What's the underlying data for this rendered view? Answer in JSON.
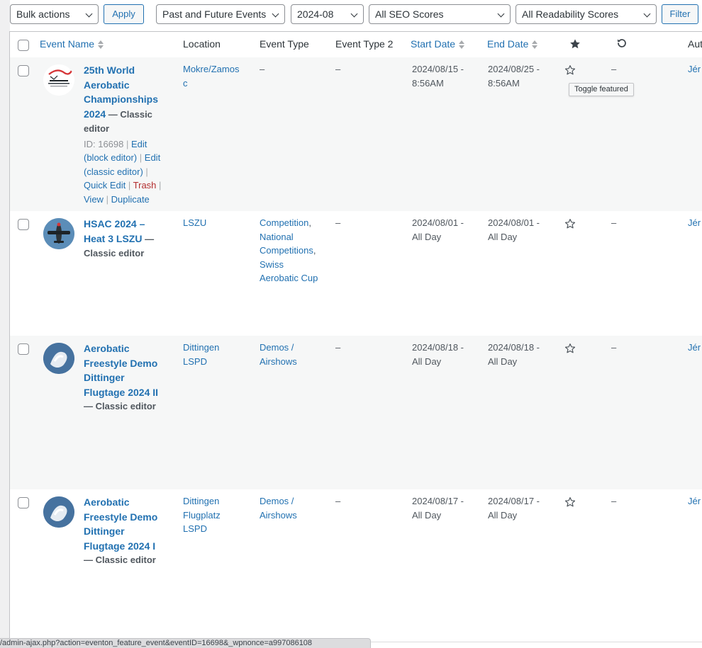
{
  "toolbar": {
    "bulk_actions": "Bulk actions",
    "apply": "Apply",
    "event_filter": "Past and Future Events",
    "month_filter": "2024-08",
    "seo_filter": "All SEO Scores",
    "readability_filter": "All Readability Scores",
    "filter": "Filter"
  },
  "columns": {
    "event_name": "Event Name",
    "location": "Location",
    "event_type": "Event Type",
    "event_type_2": "Event Type 2",
    "start_date": "Start Date",
    "end_date": "End Date",
    "featured_icon": "star-filled-icon",
    "repeat_icon": "repeat-icon",
    "author": "Aut"
  },
  "tooltip": "Toggle featured",
  "status_url": "/admin-ajax.php?action=eventon_feature_event&eventID=16698&_wpnonce=a997086108",
  "rows": [
    {
      "title_lines": [
        "25th World",
        "Aerobatic",
        "Championships"
      ],
      "title_last": "2024",
      "meta_inline": " — Classic",
      "meta_line": "editor",
      "actions": {
        "id": "ID: 16698",
        "edit_block_1": "Edit",
        "edit_block_2": "(block editor)",
        "edit_classic_1": "Edit",
        "edit_classic_2": "(classic editor)",
        "quick_edit": "Quick Edit",
        "trash": "Trash",
        "view": "View",
        "duplicate": "Duplicate"
      },
      "location_lines": [
        "Mokre/Zamos",
        "c"
      ],
      "type": "–",
      "type2": "–",
      "start": [
        "2024/08/15 -",
        "8:56AM"
      ],
      "end": [
        "2024/08/25 -",
        "8:56AM"
      ],
      "repeat": "–",
      "author": "Jér"
    },
    {
      "title_lines": [
        "HSAC 2024 –",
        "Heat 3 LSZU"
      ],
      "meta_inline": " —",
      "meta_line": "Classic editor",
      "location_lines": [
        "LSZU"
      ],
      "type_links": [
        "Competition",
        "National",
        "Competitions",
        "Swiss",
        "Aerobatic Cup"
      ],
      "type2": "–",
      "start": [
        "2024/08/01 -",
        "All Day"
      ],
      "end": [
        "2024/08/01 -",
        "All Day"
      ],
      "repeat": "–",
      "author": "Jér"
    },
    {
      "title_lines": [
        "Aerobatic",
        "Freestyle Demo",
        "Dittinger",
        "Flugtage 2024 II"
      ],
      "meta_line": "— Classic editor",
      "location_lines": [
        "Dittingen",
        "LSPD"
      ],
      "type_lines": [
        "Demos /",
        "Airshows"
      ],
      "type2": "–",
      "start": [
        "2024/08/18 -",
        "All Day"
      ],
      "end": [
        "2024/08/18 -",
        "All Day"
      ],
      "repeat": "–",
      "author": "Jér"
    },
    {
      "title_lines": [
        "Aerobatic",
        "Freestyle Demo",
        "Dittinger",
        "Flugtage 2024 I"
      ],
      "meta_line": "— Classic editor",
      "location_lines": [
        "Dittingen",
        "Flugplatz",
        "LSPD"
      ],
      "type_lines": [
        "Demos /",
        "Airshows"
      ],
      "type2": "–",
      "start": [
        "2024/08/17 -",
        "All Day"
      ],
      "end": [
        "2024/08/17 -",
        "All Day"
      ],
      "repeat": "–",
      "author": "Jér"
    }
  ]
}
